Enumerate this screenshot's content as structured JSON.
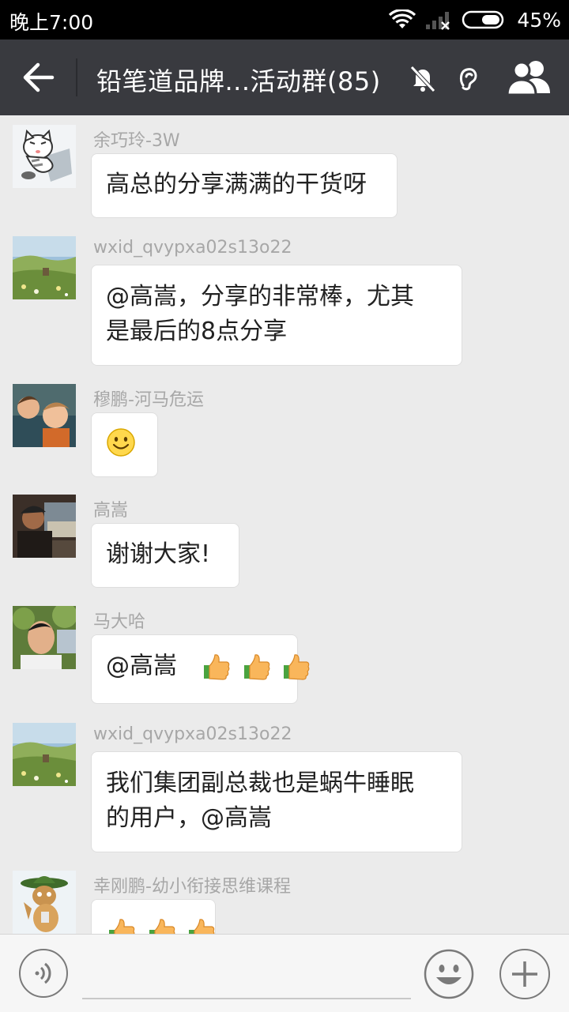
{
  "status_bar": {
    "time": "晚上7:00",
    "battery": "45%"
  },
  "header": {
    "title": "铅笔道品牌...活动群(85)"
  },
  "messages": [
    {
      "name": "余巧玲-3W",
      "text": "高总的分享满满的干货呀",
      "avatar_icon": "cat-avatar"
    },
    {
      "name": "wxid_qvypxa02s13o22",
      "line1": "@高嵩，分享的非常棒，尤其",
      "line2": "是最后的8点分享",
      "avatar_icon": "landscape-avatar"
    },
    {
      "name": "穆鹏-河马危运",
      "emoji": "smile-emoji",
      "avatar_icon": "kids-photo-avatar"
    },
    {
      "name": "高嵩",
      "text": "谢谢大家!",
      "avatar_icon": "man-photo-avatar"
    },
    {
      "name": "马大哈",
      "text": "@高嵩",
      "emoji": "thumbs-up-emoji",
      "avatar_icon": "man-portrait-avatar"
    },
    {
      "name": "wxid_qvypxa02s13o22",
      "line1": "我们集团副总裁也是蜗牛睡眠",
      "line2": "的用户，@高嵩",
      "avatar_icon": "landscape-avatar"
    },
    {
      "name": "幸刚鹏-幼小衔接思维课程",
      "emoji": "thumbs-up-emoji",
      "avatar_icon": "cartoon-scout-avatar"
    }
  ],
  "colors": {
    "header_bg": "#393a3f",
    "chat_bg": "#ebebeb",
    "status_bg": "#000000",
    "bubble_bg": "#ffffff"
  }
}
